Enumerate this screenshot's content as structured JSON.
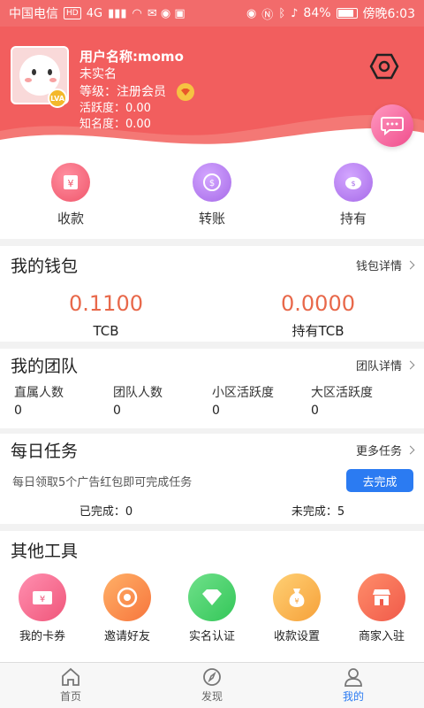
{
  "status_bar": {
    "carrier": "中国电信",
    "hd_badge": "HD",
    "network": "4G",
    "battery": "84%",
    "time": "傍晚6:03"
  },
  "profile": {
    "name": "用户名称:momo",
    "verify_status": "未实名",
    "level": "等级：注册会员",
    "activity": "活跃度：0.00",
    "fame": "知名度：0.00",
    "avatar_badge": "LVA"
  },
  "quick_actions": [
    {
      "label": "收款",
      "icon": "atm-icon",
      "color": "#f0566b"
    },
    {
      "label": "转账",
      "icon": "transfer-icon",
      "color": "#a66ae8"
    },
    {
      "label": "持有",
      "icon": "piggy-bank-icon",
      "color": "#a66ae8"
    }
  ],
  "wallet": {
    "title": "我的钱包",
    "link": "钱包详情",
    "items": [
      {
        "value": "0.1100",
        "unit": "TCB"
      },
      {
        "value": "0.0000",
        "unit": "持有TCB"
      }
    ]
  },
  "team": {
    "title": "我的团队",
    "link": "团队详情",
    "items": [
      {
        "label": "直属人数",
        "value": "0"
      },
      {
        "label": "团队人数",
        "value": "0"
      },
      {
        "label": "小区活跃度",
        "value": "0"
      },
      {
        "label": "大区活跃度",
        "value": "0"
      }
    ]
  },
  "daily_task": {
    "title": "每日任务",
    "link": "更多任务",
    "description": "每日领取5个广告红包即可完成任务",
    "button": "去完成",
    "done": "已完成：0",
    "undone": "未完成：5"
  },
  "tools": {
    "title": "其他工具",
    "items": [
      {
        "label": "我的卡券",
        "icon": "coupon-icon",
        "color": "#f0567a"
      },
      {
        "label": "邀请好友",
        "icon": "aperture-icon",
        "color": "#f7763d"
      },
      {
        "label": "实名认证",
        "icon": "diamond-icon",
        "color": "#34c759"
      },
      {
        "label": "收款设置",
        "icon": "money-bag-icon",
        "color": "#f6a13a"
      },
      {
        "label": "商家入驻",
        "icon": "shop-icon",
        "color": "#f05a4a"
      }
    ]
  },
  "bottom_nav": [
    {
      "label": "首页",
      "icon": "home-icon",
      "active": false
    },
    {
      "label": "发现",
      "icon": "compass-icon",
      "active": false
    },
    {
      "label": "我的",
      "icon": "user-icon",
      "active": true
    }
  ],
  "colors": {
    "header": "#f25e5e",
    "accent_blue": "#2b7bf2",
    "value_orange": "#e8684a"
  }
}
